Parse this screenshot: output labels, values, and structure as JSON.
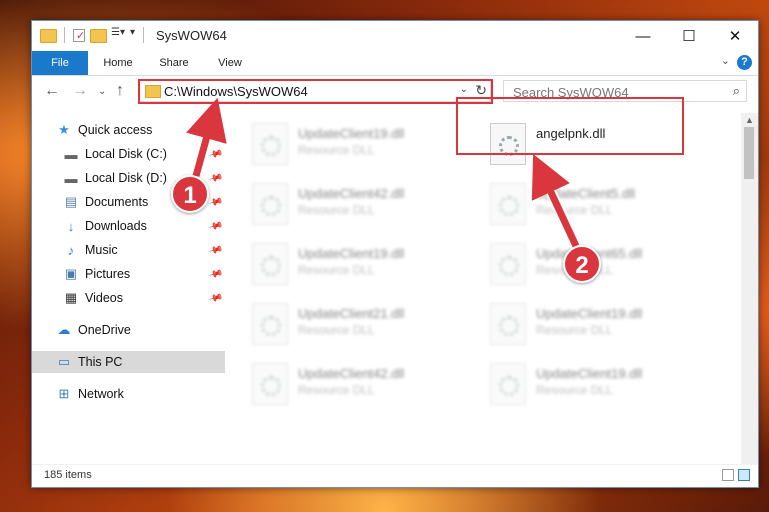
{
  "window": {
    "title": "SysWOW64",
    "controls": {
      "minimize": "—",
      "maximize": "☐",
      "close": "✕"
    }
  },
  "ribbon": {
    "tabs": [
      {
        "label": "File"
      },
      {
        "label": "Home"
      },
      {
        "label": "Share"
      },
      {
        "label": "View"
      }
    ],
    "help_label": "?"
  },
  "address_bar": {
    "path": "C:\\Windows\\SysWOW64",
    "search_placeholder": "Search SysWOW64"
  },
  "sidebar": {
    "items": [
      {
        "label": "Quick access",
        "icon": "star-icon"
      },
      {
        "label": "Local Disk (C:)",
        "icon": "drive-icon"
      },
      {
        "label": "Local Disk (D:)",
        "icon": "drive-icon"
      },
      {
        "label": "Documents",
        "icon": "document-icon"
      },
      {
        "label": "Downloads",
        "icon": "download-icon"
      },
      {
        "label": "Music",
        "icon": "music-icon"
      },
      {
        "label": "Pictures",
        "icon": "pictures-icon"
      },
      {
        "label": "Videos",
        "icon": "video-icon"
      },
      {
        "label": "OneDrive",
        "icon": "cloud-icon"
      },
      {
        "label": "This PC",
        "icon": "computer-icon"
      },
      {
        "label": "Network",
        "icon": "network-icon"
      }
    ]
  },
  "files": {
    "left_column": [
      {
        "name": "UpdateClient19.dll",
        "type": "Resource DLL"
      },
      {
        "name": "UpdateClient42.dll",
        "type": "Resource DLL"
      },
      {
        "name": "UpdateClient19.dll",
        "type": "Resource DLL"
      },
      {
        "name": "UpdateClient21.dll",
        "type": "Resource DLL"
      },
      {
        "name": "UpdateClient42.dll",
        "type": "Resource DLL"
      }
    ],
    "right_column": [
      {
        "name": "angelpnk.dll",
        "type": ""
      },
      {
        "name": "UpdateClient5.dll",
        "type": "Resource DLL"
      },
      {
        "name": "UpdateClient65.dll",
        "type": "Resource DLL"
      },
      {
        "name": "UpdateClient19.dll",
        "type": "Resource DLL"
      },
      {
        "name": "UpdateClient19.dll",
        "type": "Resource DLL"
      }
    ]
  },
  "status": {
    "item_count": "185 items"
  },
  "callouts": [
    {
      "label": "1"
    },
    {
      "label": "2"
    }
  ],
  "colors": {
    "accent": "#1979ca",
    "highlight": "#d9363e",
    "selection": "#cce8ff"
  }
}
